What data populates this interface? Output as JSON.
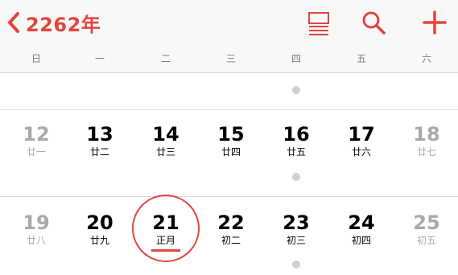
{
  "header": {
    "year_label": "2262年",
    "icons": {
      "back": "chevron-left-icon",
      "list": "list-view-icon",
      "search": "search-icon",
      "add": "plus-icon"
    },
    "accent_color": "#e1453d"
  },
  "weekdays": [
    "日",
    "一",
    "二",
    "三",
    "四",
    "五",
    "六"
  ],
  "weeks": [
    {
      "dates": [],
      "event_dot_weekday_index": 4
    },
    {
      "days": [
        {
          "number": "12",
          "lunar": "廿一",
          "weekend": true
        },
        {
          "number": "13",
          "lunar": "廿二",
          "weekend": false
        },
        {
          "number": "14",
          "lunar": "廿三",
          "weekend": false
        },
        {
          "number": "15",
          "lunar": "廿四",
          "weekend": false
        },
        {
          "number": "16",
          "lunar": "廿五",
          "weekend": false
        },
        {
          "number": "17",
          "lunar": "廿六",
          "weekend": false
        },
        {
          "number": "18",
          "lunar": "廿七",
          "weekend": true
        }
      ],
      "event_dot_weekday_index": 4
    },
    {
      "days": [
        {
          "number": "19",
          "lunar": "廿八",
          "weekend": true
        },
        {
          "number": "20",
          "lunar": "廿九",
          "weekend": false
        },
        {
          "number": "21",
          "lunar": "正月",
          "weekend": false,
          "today": true
        },
        {
          "number": "22",
          "lunar": "初二",
          "weekend": false
        },
        {
          "number": "23",
          "lunar": "初三",
          "weekend": false
        },
        {
          "number": "24",
          "lunar": "初四",
          "weekend": false
        },
        {
          "number": "25",
          "lunar": "初五",
          "weekend": true
        }
      ],
      "event_dot_weekday_index": 4
    }
  ]
}
